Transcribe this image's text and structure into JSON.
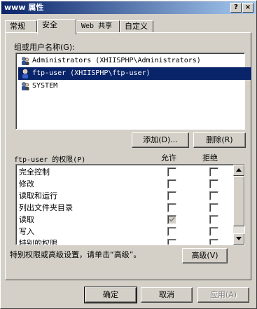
{
  "window": {
    "title": "www 属性",
    "help_label": "?",
    "close_label": "×"
  },
  "tabs": [
    {
      "label": "常规"
    },
    {
      "label": "安全"
    },
    {
      "label": "Web 共享"
    },
    {
      "label": "自定义"
    }
  ],
  "users_section": {
    "label": "组或用户名称(G):",
    "users": [
      {
        "name": "Administrators (XHIISPHP\\Administrators)",
        "selected": false
      },
      {
        "name": "ftp-user (XHIISPHP\\ftp-user)",
        "selected": true
      },
      {
        "name": "SYSTEM",
        "selected": false
      }
    ],
    "add_label": "添加(D)...",
    "remove_label": "删除(R)"
  },
  "permissions": {
    "label": "ftp-user 的权限(P)",
    "allow_header": "允许",
    "deny_header": "拒绝",
    "items": [
      {
        "label": "完全控制",
        "allow": false,
        "deny": false,
        "allow_disabled": false
      },
      {
        "label": "修改",
        "allow": false,
        "deny": false,
        "allow_disabled": false
      },
      {
        "label": "读取和运行",
        "allow": false,
        "deny": false,
        "allow_disabled": false
      },
      {
        "label": "列出文件夹目录",
        "allow": false,
        "deny": false,
        "allow_disabled": false
      },
      {
        "label": "读取",
        "allow": true,
        "deny": false,
        "allow_disabled": true
      },
      {
        "label": "写入",
        "allow": false,
        "deny": false,
        "allow_disabled": false
      },
      {
        "label": "特别的权限",
        "allow": false,
        "deny": false,
        "allow_disabled": false
      }
    ]
  },
  "advanced": {
    "hint": "特别权限或高级设置，请单击“高级”。",
    "button_label": "高级(V)"
  },
  "footer": {
    "ok_label": "确定",
    "cancel_label": "取消",
    "apply_label": "应用(A)"
  },
  "colors": {
    "title_active": "#0a246a",
    "face": "#d4d0c8",
    "selection": "#0a246a"
  }
}
